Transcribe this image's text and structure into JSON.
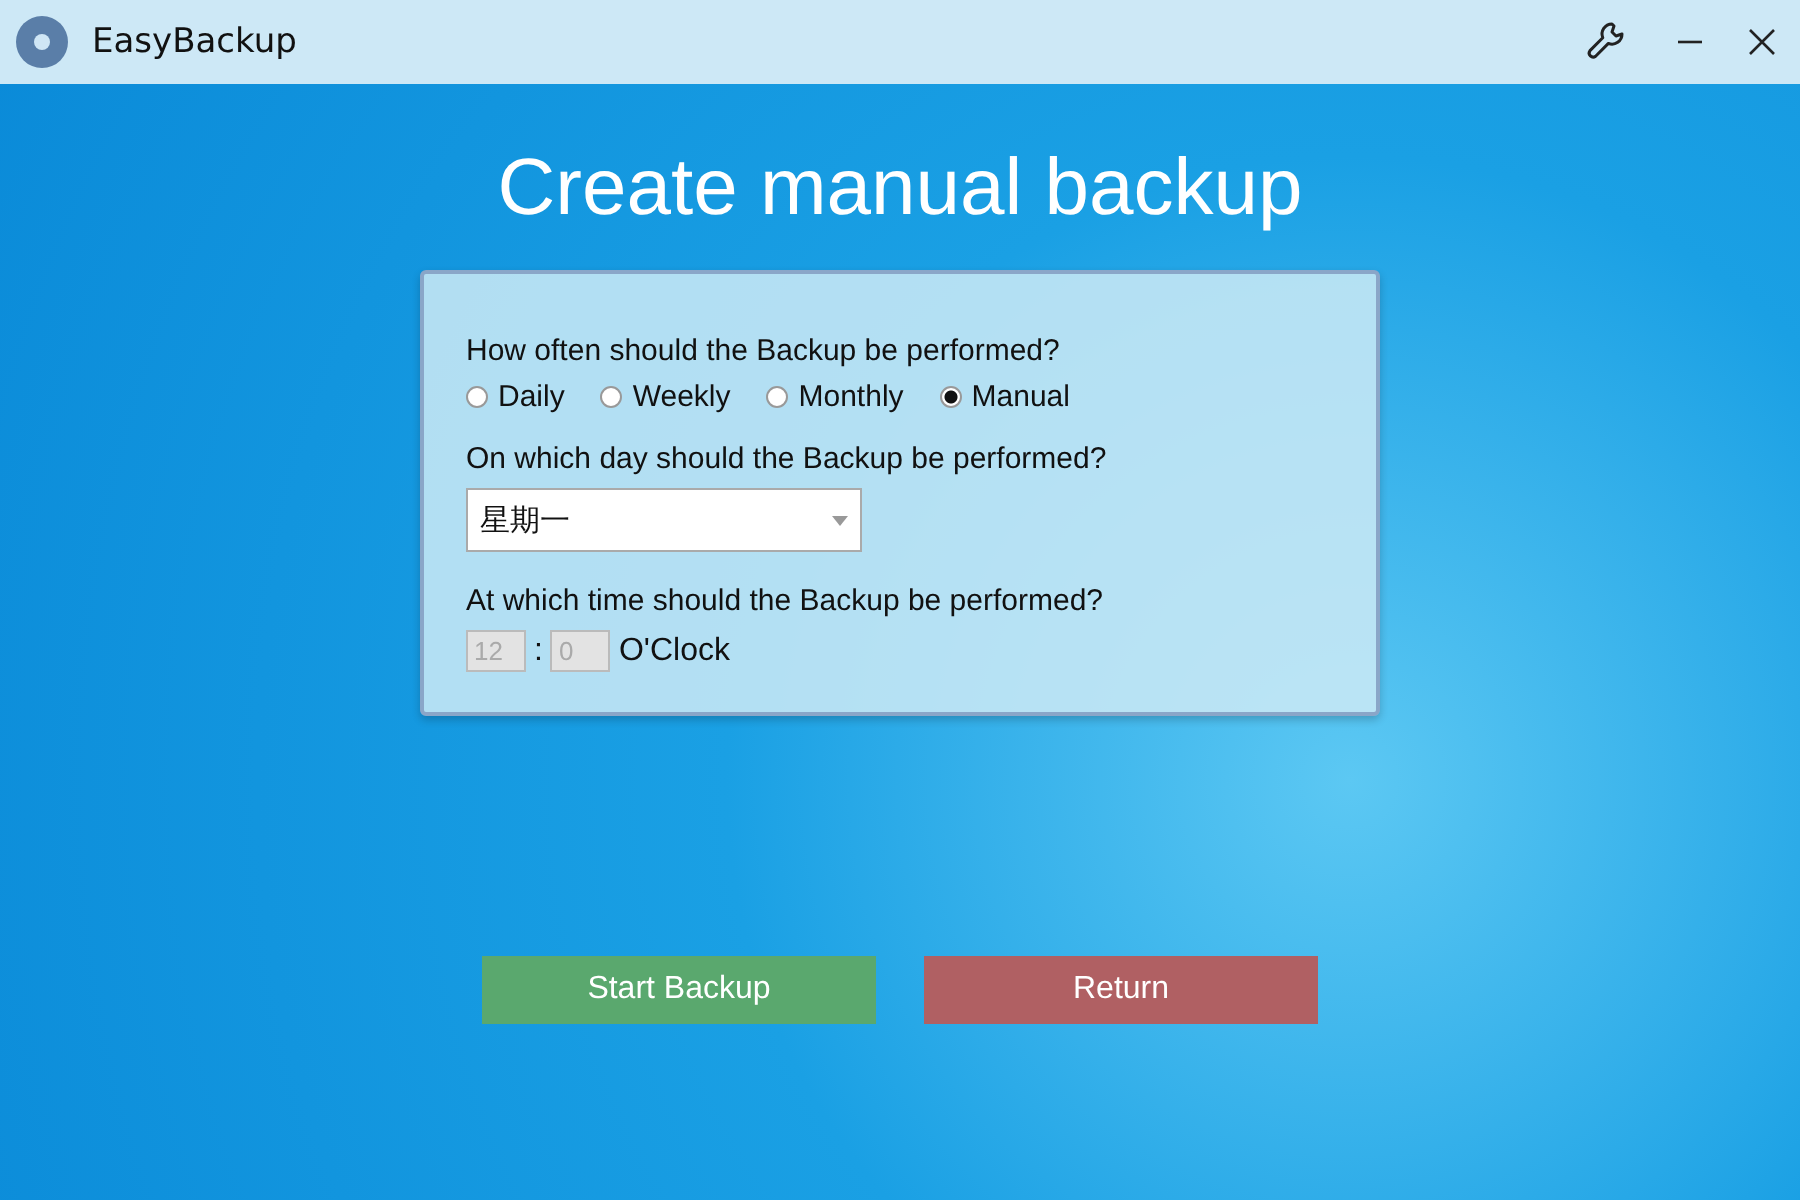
{
  "window": {
    "title": "EasyBackup"
  },
  "heading": "Create manual backup",
  "frequency": {
    "label": "How often should the Backup be performed?",
    "options": [
      {
        "label": "Daily",
        "selected": false
      },
      {
        "label": "Weekly",
        "selected": false
      },
      {
        "label": "Monthly",
        "selected": false
      },
      {
        "label": "Manual",
        "selected": true
      }
    ]
  },
  "day": {
    "label": "On which day should the Backup be performed?",
    "value": "星期一"
  },
  "time": {
    "label": "At which time should the Backup be performed?",
    "hour": "12",
    "separator": ":",
    "minute": "0",
    "disabled": true,
    "suffix": "O'Clock"
  },
  "buttons": [
    {
      "label": "Start Backup",
      "kind": "start"
    },
    {
      "label": "Return",
      "kind": "return"
    }
  ]
}
